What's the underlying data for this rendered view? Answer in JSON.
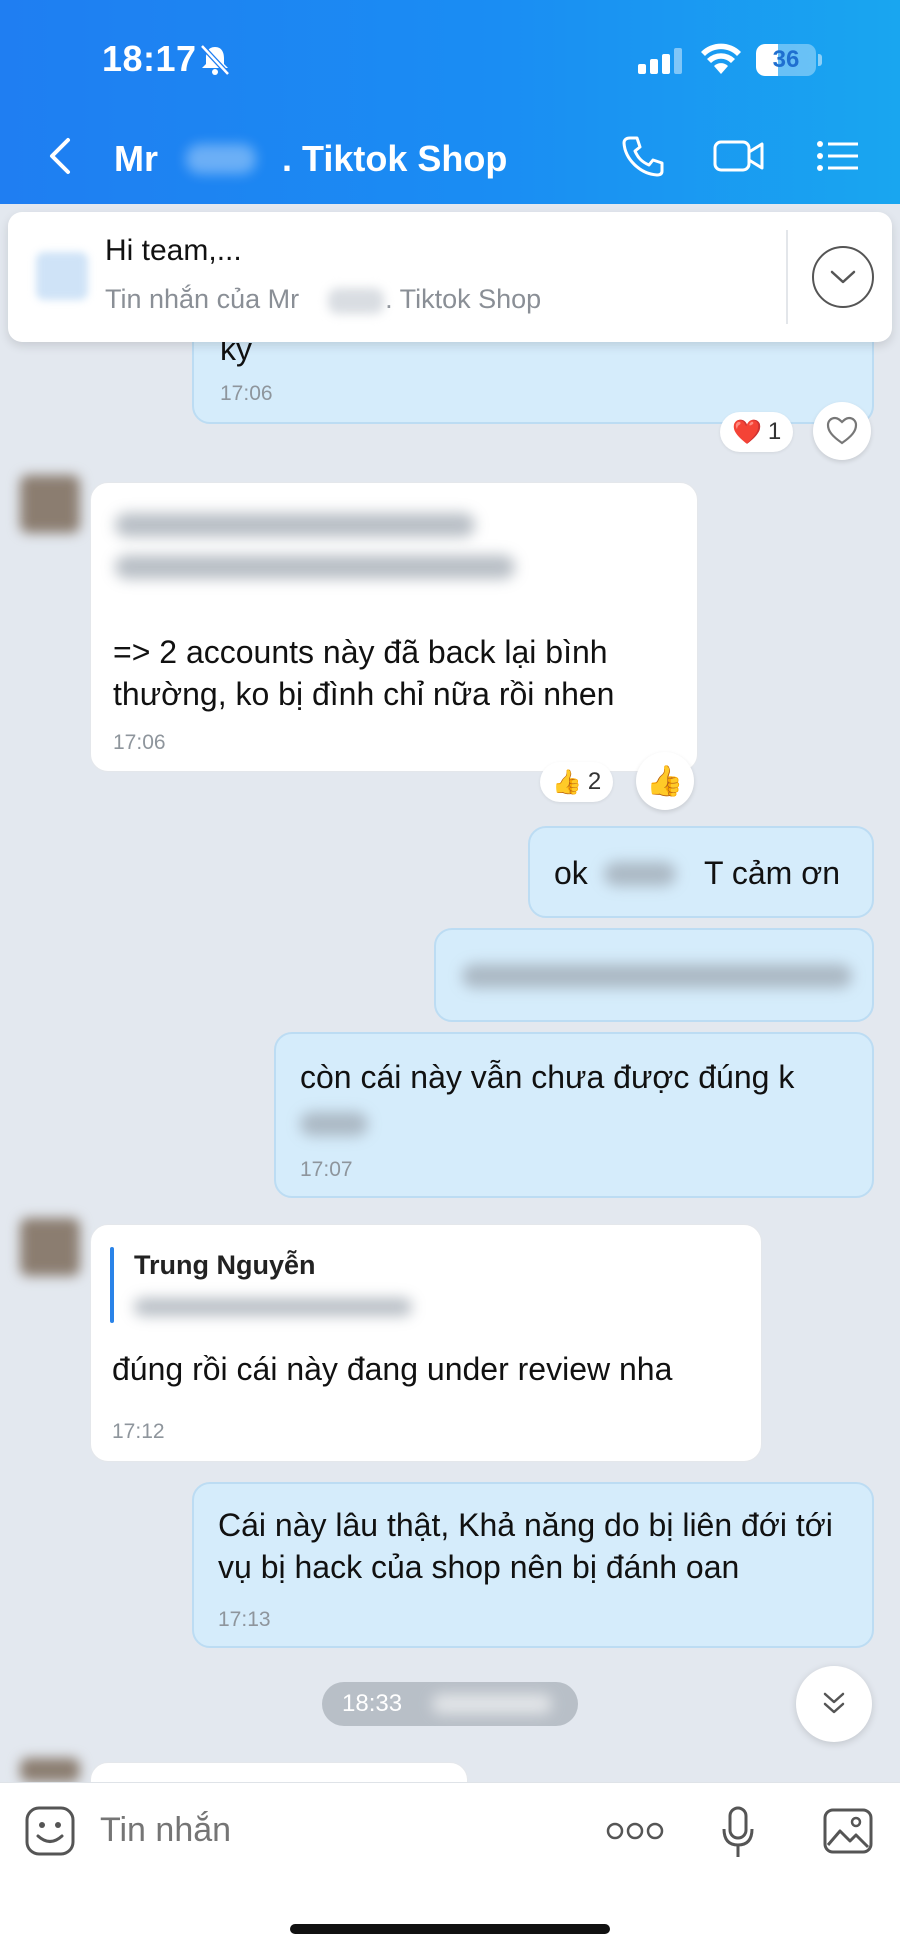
{
  "status_bar": {
    "time": "18:17",
    "battery": "36",
    "battery_level": 0.36
  },
  "header": {
    "title_prefix": "Mr",
    "title_suffix": ". Tiktok Shop",
    "back": "back-arrow",
    "call": "phone-icon",
    "video": "video-call-icon",
    "menu": "list-menu-icon"
  },
  "pinned": {
    "text": "Hi team,...",
    "sub_prefix": "Tin nhắn của Mr",
    "sub_suffix": ". Tiktok Shop"
  },
  "messages": [
    {
      "id": "m1",
      "side": "mine",
      "text": "ky",
      "time": "17:06",
      "reaction": {
        "emoji": "❤️",
        "count": "1"
      }
    },
    {
      "id": "m2",
      "side": "theirs",
      "text": "=> 2 accounts này đã back lại bình thường, ko bị đình chỉ nữa rồi nhen",
      "time": "17:06",
      "reaction": {
        "emoji": "👍",
        "count": "2"
      }
    },
    {
      "id": "m3",
      "side": "mine",
      "text_a": "ok",
      "text_b": "T cảm ơn"
    },
    {
      "id": "m4",
      "side": "mine",
      "text": ""
    },
    {
      "id": "m5",
      "side": "mine",
      "text": "còn cái này vẫn chưa được đúng k",
      "time": "17:07"
    },
    {
      "id": "m6",
      "side": "theirs",
      "quote_name": "Trung Nguyễn",
      "text": "đúng rồi cái này đang under review nha",
      "time": "17:12"
    },
    {
      "id": "m7",
      "side": "mine",
      "text": "Cái này lâu thật, Khả năng do bị liên đới tới vụ bị hack của shop nên bị đánh oan",
      "time": "17:13"
    }
  ],
  "time_chip": "18:33",
  "composer": {
    "placeholder": "Tin nhắn"
  },
  "colors": {
    "header_start": "#1f7ef2",
    "header_end": "#19a6f0",
    "bubble_mine": "#d5ecfb",
    "bubble_theirs": "#ffffff",
    "background": "#e3e8ef"
  }
}
